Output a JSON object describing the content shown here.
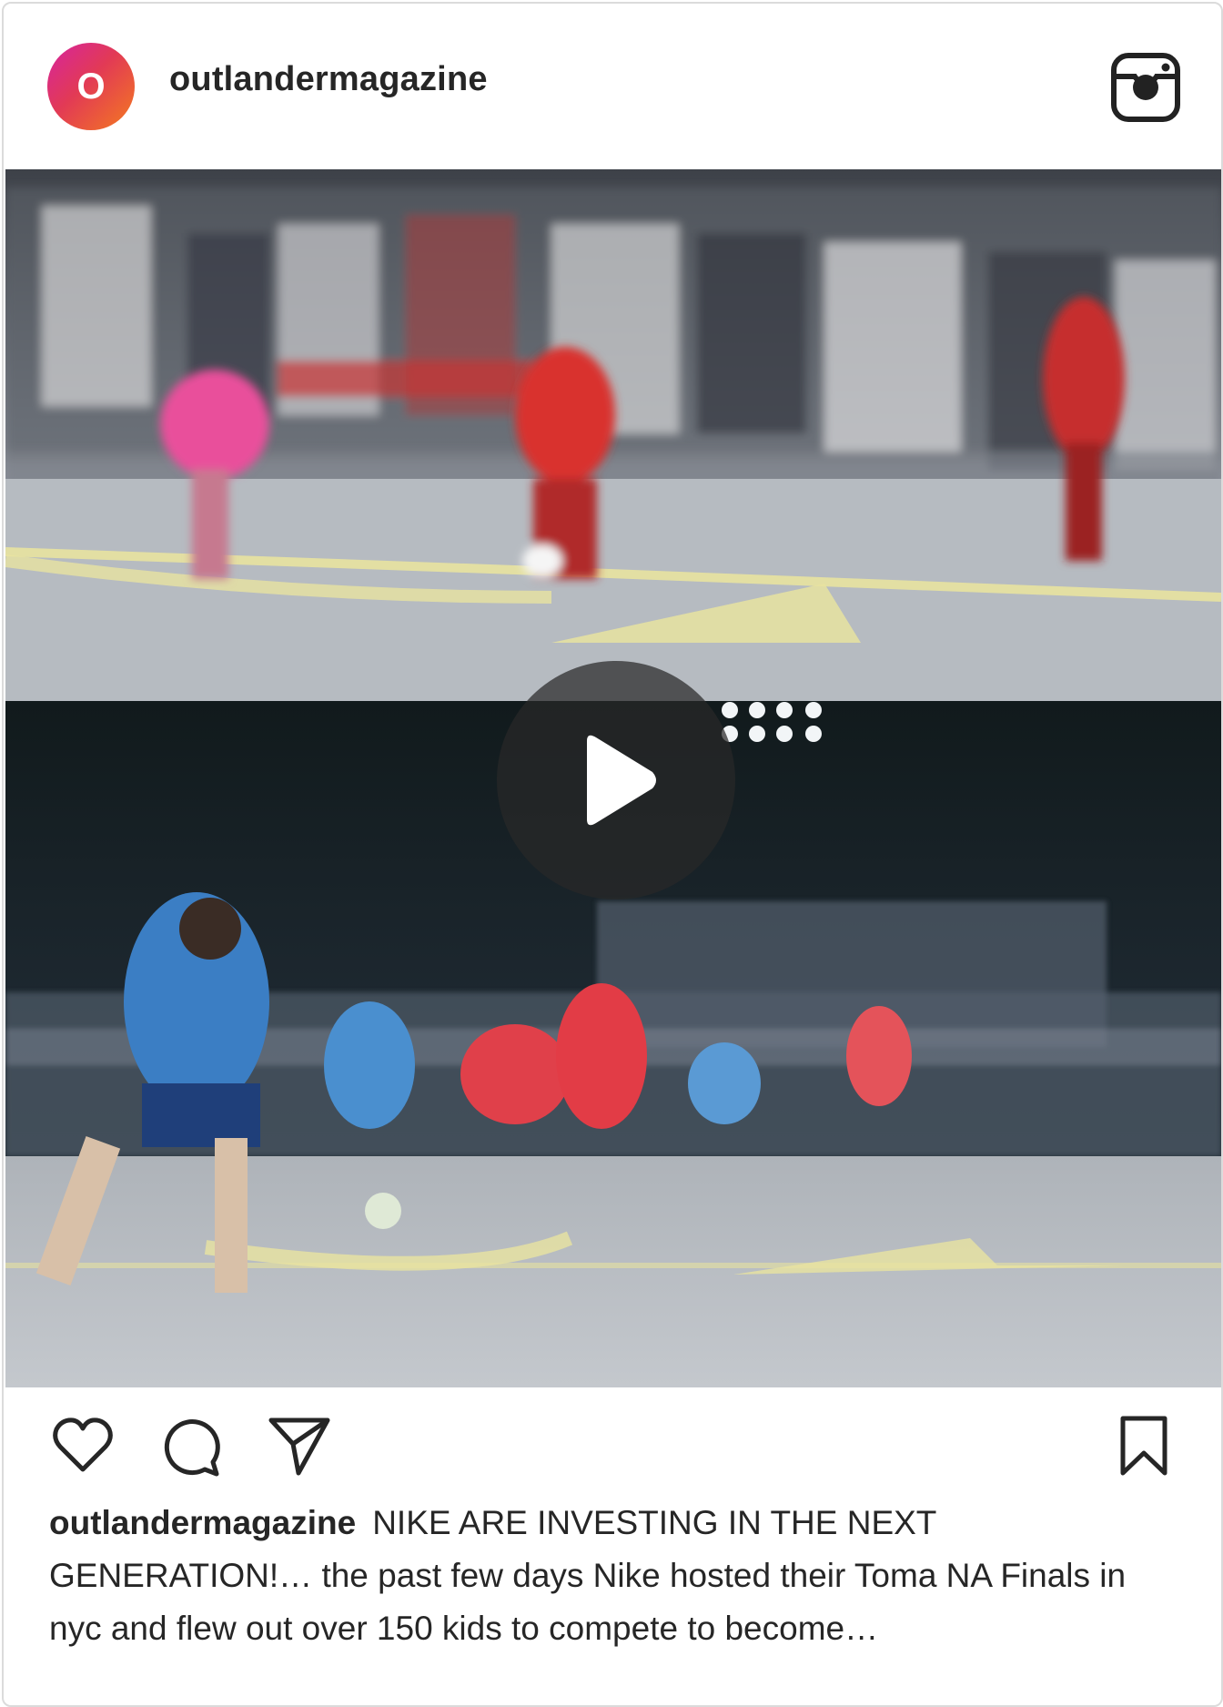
{
  "post": {
    "avatar_letter": "O",
    "username": "outlandermagazine",
    "caption_user": "outlandermagazine",
    "caption_text": "NIKE ARE INVESTING IN THE NEXT GENERATION!… the past few days Nike hosted their Toma NA Finals in nyc and flew out over 150 kids to compete to become…"
  },
  "icons": {
    "brand": "instagram-icon",
    "play": "play-icon",
    "like": "heart-icon",
    "comment": "comment-icon",
    "share": "paper-plane-icon",
    "save": "bookmark-icon"
  },
  "colors": {
    "avatar_gradient_start": "#d6249f",
    "avatar_gradient_end": "#f47a1f",
    "text": "#262626",
    "border": "#dbdbdb"
  }
}
